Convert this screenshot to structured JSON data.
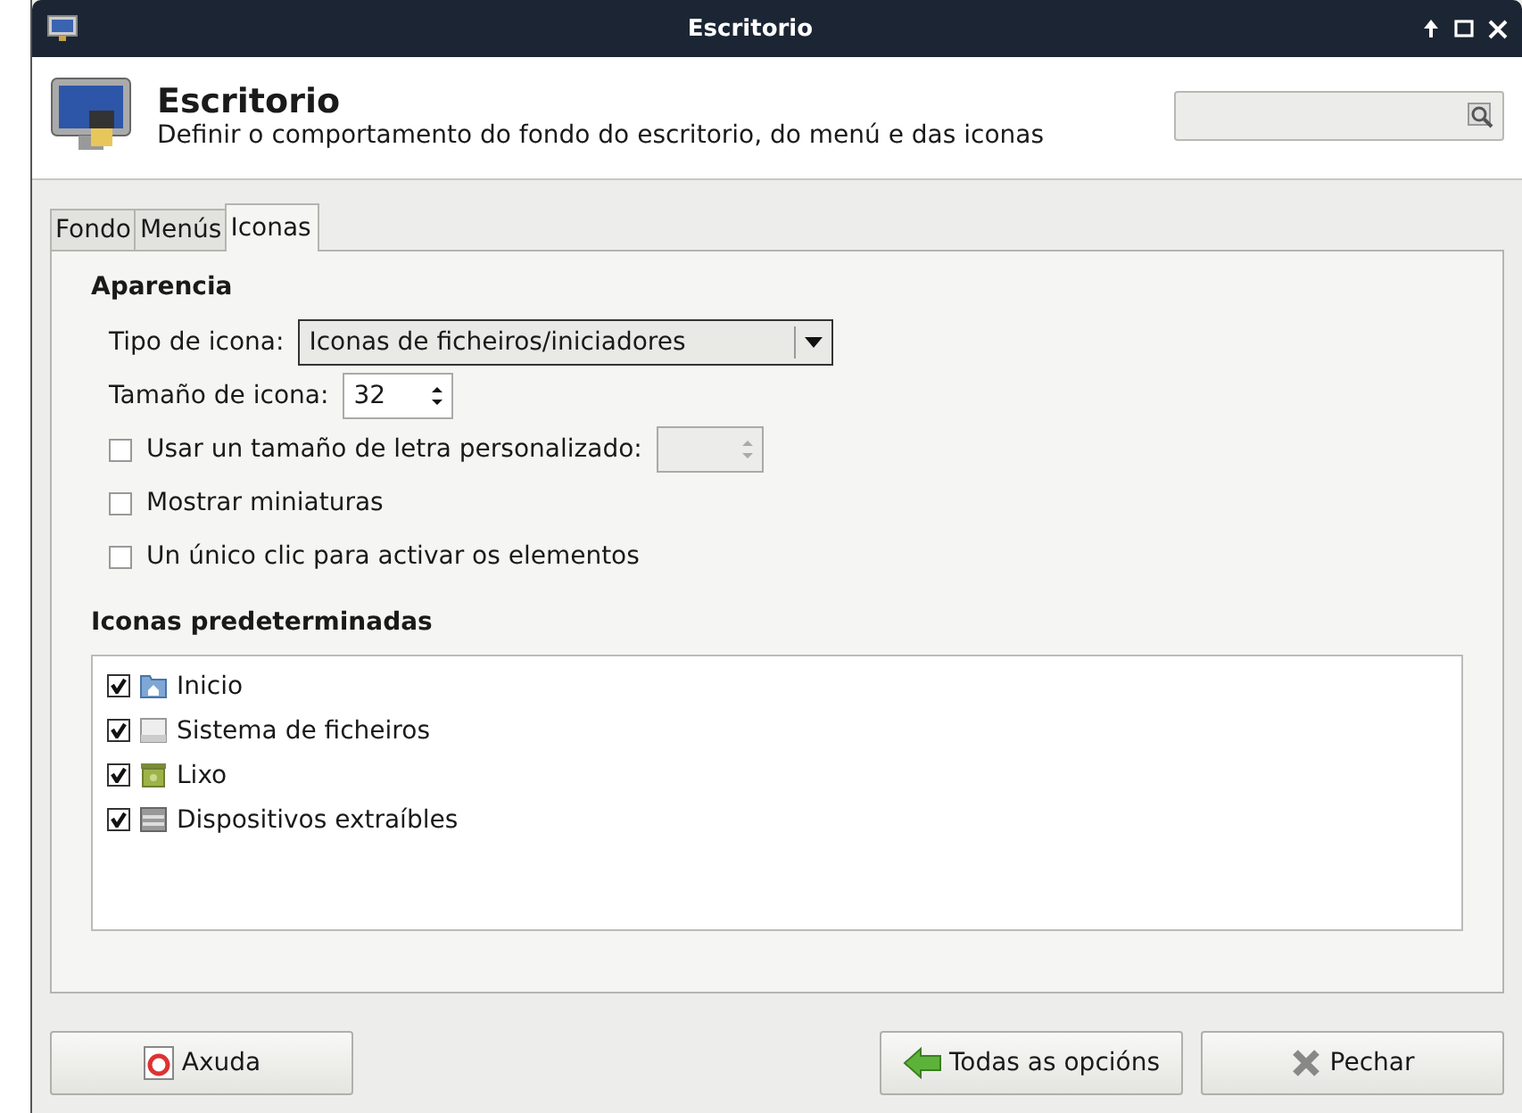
{
  "window": {
    "title": "Escritorio"
  },
  "header": {
    "title": "Escritorio",
    "description": "Definir o comportamento do fondo do escritorio, do menú e das iconas"
  },
  "tabs": [
    {
      "label": "Fondo",
      "selected": false
    },
    {
      "label": "Menús",
      "selected": false
    },
    {
      "label": "Iconas",
      "selected": true
    }
  ],
  "appearance": {
    "heading": "Aparencia",
    "icon_type": {
      "label": "Tipo de icona:",
      "value": "Iconas de ficheiros/iniciadores"
    },
    "icon_size": {
      "label": "Tamaño de icona:",
      "value": "32"
    },
    "options": [
      {
        "label": "Usar un tamaño de letra personalizado:",
        "checked": false,
        "kind": "spin"
      },
      {
        "label": "Mostrar miniaturas",
        "checked": false,
        "kind": "plain"
      },
      {
        "label": "Un único clic para activar os elementos",
        "checked": false,
        "kind": "plain"
      }
    ]
  },
  "default_icons": {
    "heading": "Iconas predeterminadas",
    "items": [
      {
        "label": "Inicio",
        "checked": true,
        "kind": "home"
      },
      {
        "label": "Sistema de ficheiros",
        "checked": true,
        "kind": "drive"
      },
      {
        "label": "Lixo",
        "checked": true,
        "kind": "trash"
      },
      {
        "label": "Dispositivos extraíbles",
        "checked": true,
        "kind": "removable"
      }
    ]
  },
  "buttons": [
    {
      "label": "Axuda",
      "kind": "help"
    },
    {
      "label": "Todas as opcións",
      "kind": "back"
    },
    {
      "label": "Pechar",
      "kind": "close"
    }
  ]
}
